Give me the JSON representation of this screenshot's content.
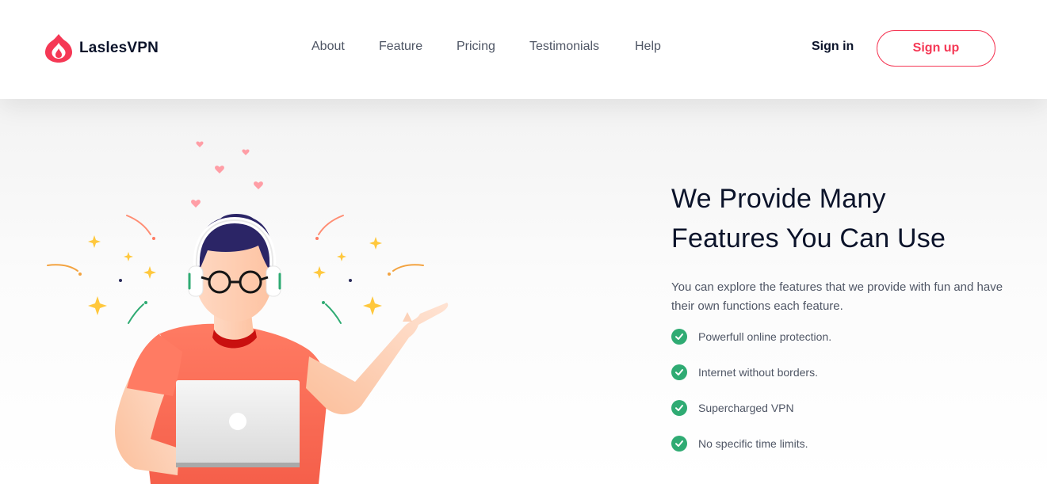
{
  "header": {
    "brand": "LaslesVPN",
    "nav": [
      {
        "label": "About"
      },
      {
        "label": "Feature"
      },
      {
        "label": "Pricing"
      },
      {
        "label": "Testimonials"
      },
      {
        "label": "Help"
      }
    ],
    "sign_in": "Sign in",
    "sign_up": "Sign up"
  },
  "hero": {
    "title_line1": "We Provide Many",
    "title_line2": "Features You Can Use",
    "description": "You can explore the features that we provide with fun and have their own functions each feature.",
    "features": [
      "Powerfull online protection.",
      "Internet without borders.",
      "Supercharged VPN",
      "No specific time limits."
    ]
  },
  "colors": {
    "accent": "#f53855",
    "check": "#2fab73",
    "heading": "#0b132a",
    "body": "#4f5665"
  },
  "icons": {
    "logo": "flame-logo-icon",
    "check": "check-circle-icon"
  }
}
